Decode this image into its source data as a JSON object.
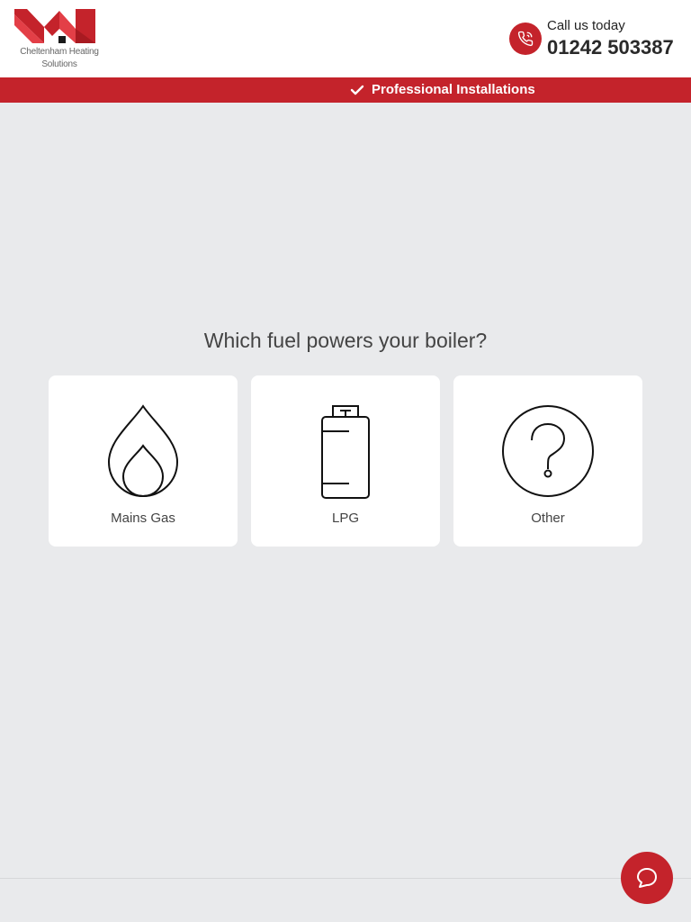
{
  "header": {
    "logo": {
      "line1": "Cheltenham Heating",
      "line2": "Solutions",
      "icon": "house-roof-logo"
    },
    "call": {
      "label": "Call us today",
      "number": "01242 503387",
      "icon": "phone-icon"
    }
  },
  "banner": {
    "icon": "checkmark-icon",
    "text": "Professional Installations"
  },
  "main": {
    "question": "Which fuel powers your boiler?",
    "options": [
      {
        "label": "Mains Gas",
        "icon": "flame-icon"
      },
      {
        "label": "LPG",
        "icon": "gas-bottle-icon"
      },
      {
        "label": "Other",
        "icon": "question-circle-icon"
      }
    ]
  },
  "chat": {
    "icon": "chat-bubble-icon"
  },
  "colors": {
    "brand_red": "#c4232b",
    "background": "#e9eaec",
    "card": "#ffffff",
    "text": "#444444"
  }
}
